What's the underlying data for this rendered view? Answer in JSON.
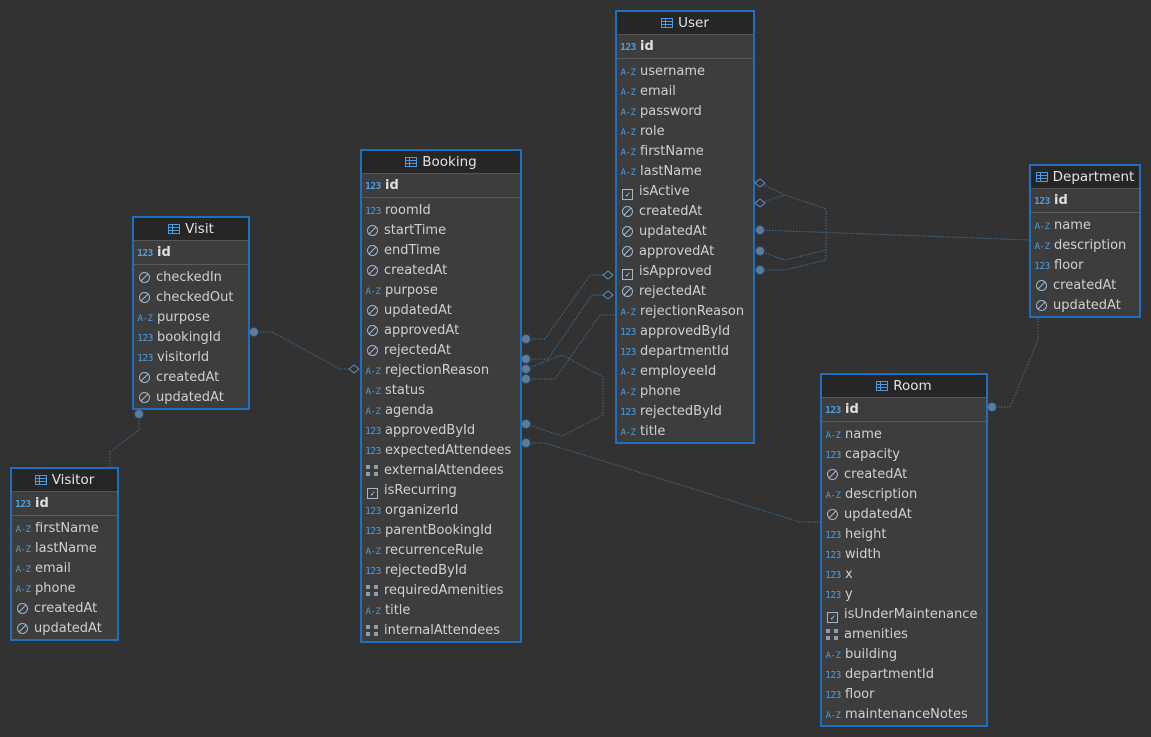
{
  "colors": {
    "background": "#323232",
    "entity_border": "#1e6fc0",
    "link": "#3f6f95",
    "icon": "#4d9de0"
  },
  "entities": {
    "user": {
      "title": "User",
      "pk": {
        "type": "num",
        "icon_text": "123",
        "name": "id"
      },
      "fields": [
        {
          "type": "az",
          "icon_text": "A-Z",
          "name": "username"
        },
        {
          "type": "az",
          "icon_text": "A-Z",
          "name": "email"
        },
        {
          "type": "az",
          "icon_text": "A-Z",
          "name": "password"
        },
        {
          "type": "az",
          "icon_text": "A-Z",
          "name": "role"
        },
        {
          "type": "az",
          "icon_text": "A-Z",
          "name": "firstName"
        },
        {
          "type": "az",
          "icon_text": "A-Z",
          "name": "lastName"
        },
        {
          "type": "bool",
          "icon_text": "✓",
          "name": "isActive"
        },
        {
          "type": "time",
          "icon_text": "",
          "name": "createdAt"
        },
        {
          "type": "time",
          "icon_text": "",
          "name": "updatedAt"
        },
        {
          "type": "time",
          "icon_text": "",
          "name": "approvedAt"
        },
        {
          "type": "bool",
          "icon_text": "✓",
          "name": "isApproved"
        },
        {
          "type": "time",
          "icon_text": "",
          "name": "rejectedAt"
        },
        {
          "type": "az",
          "icon_text": "A-Z",
          "name": "rejectionReason"
        },
        {
          "type": "num",
          "icon_text": "123",
          "name": "approvedById"
        },
        {
          "type": "num",
          "icon_text": "123",
          "name": "departmentId"
        },
        {
          "type": "az",
          "icon_text": "A-Z",
          "name": "employeeId"
        },
        {
          "type": "az",
          "icon_text": "A-Z",
          "name": "phone"
        },
        {
          "type": "num",
          "icon_text": "123",
          "name": "rejectedById"
        },
        {
          "type": "az",
          "icon_text": "A-Z",
          "name": "title"
        }
      ]
    },
    "booking": {
      "title": "Booking",
      "pk": {
        "type": "num",
        "icon_text": "123",
        "name": "id"
      },
      "fields": [
        {
          "type": "num",
          "icon_text": "123",
          "name": "roomId"
        },
        {
          "type": "time",
          "icon_text": "",
          "name": "startTime"
        },
        {
          "type": "time",
          "icon_text": "",
          "name": "endTime"
        },
        {
          "type": "time",
          "icon_text": "",
          "name": "createdAt"
        },
        {
          "type": "az",
          "icon_text": "A-Z",
          "name": "purpose"
        },
        {
          "type": "time",
          "icon_text": "",
          "name": "updatedAt"
        },
        {
          "type": "time",
          "icon_text": "",
          "name": "approvedAt"
        },
        {
          "type": "time",
          "icon_text": "",
          "name": "rejectedAt"
        },
        {
          "type": "az",
          "icon_text": "A-Z",
          "name": "rejectionReason"
        },
        {
          "type": "az",
          "icon_text": "A-Z",
          "name": "status"
        },
        {
          "type": "az",
          "icon_text": "A-Z",
          "name": "agenda"
        },
        {
          "type": "num",
          "icon_text": "123",
          "name": "approvedById"
        },
        {
          "type": "num",
          "icon_text": "123",
          "name": "expectedAttendees"
        },
        {
          "type": "arr",
          "icon_text": "",
          "name": "externalAttendees"
        },
        {
          "type": "bool",
          "icon_text": "✓",
          "name": "isRecurring"
        },
        {
          "type": "num",
          "icon_text": "123",
          "name": "organizerId"
        },
        {
          "type": "num",
          "icon_text": "123",
          "name": "parentBookingId"
        },
        {
          "type": "az",
          "icon_text": "A-Z",
          "name": "recurrenceRule"
        },
        {
          "type": "num",
          "icon_text": "123",
          "name": "rejectedById"
        },
        {
          "type": "arr",
          "icon_text": "",
          "name": "requiredAmenities"
        },
        {
          "type": "az",
          "icon_text": "A-Z",
          "name": "title"
        },
        {
          "type": "arr",
          "icon_text": "",
          "name": "internalAttendees"
        }
      ]
    },
    "visit": {
      "title": "Visit",
      "pk": {
        "type": "num",
        "icon_text": "123",
        "name": "id"
      },
      "fields": [
        {
          "type": "time",
          "icon_text": "",
          "name": "checkedIn"
        },
        {
          "type": "time",
          "icon_text": "",
          "name": "checkedOut"
        },
        {
          "type": "az",
          "icon_text": "A-Z",
          "name": "purpose"
        },
        {
          "type": "num",
          "icon_text": "123",
          "name": "bookingId"
        },
        {
          "type": "num",
          "icon_text": "123",
          "name": "visitorId"
        },
        {
          "type": "time",
          "icon_text": "",
          "name": "createdAt"
        },
        {
          "type": "time",
          "icon_text": "",
          "name": "updatedAt"
        }
      ]
    },
    "visitor": {
      "title": "Visitor",
      "pk": {
        "type": "num",
        "icon_text": "123",
        "name": "id"
      },
      "fields": [
        {
          "type": "az",
          "icon_text": "A-Z",
          "name": "firstName"
        },
        {
          "type": "az",
          "icon_text": "A-Z",
          "name": "lastName"
        },
        {
          "type": "az",
          "icon_text": "A-Z",
          "name": "email"
        },
        {
          "type": "az",
          "icon_text": "A-Z",
          "name": "phone"
        },
        {
          "type": "time",
          "icon_text": "",
          "name": "createdAt"
        },
        {
          "type": "time",
          "icon_text": "",
          "name": "updatedAt"
        }
      ]
    },
    "department": {
      "title": "Department",
      "pk": {
        "type": "num",
        "icon_text": "123",
        "name": "id"
      },
      "fields": [
        {
          "type": "az",
          "icon_text": "A-Z",
          "name": "name"
        },
        {
          "type": "az",
          "icon_text": "A-Z",
          "name": "description"
        },
        {
          "type": "num",
          "icon_text": "123",
          "name": "floor"
        },
        {
          "type": "time",
          "icon_text": "",
          "name": "createdAt"
        },
        {
          "type": "time",
          "icon_text": "",
          "name": "updatedAt"
        }
      ]
    },
    "room": {
      "title": "Room",
      "pk": {
        "type": "num",
        "icon_text": "123",
        "name": "id"
      },
      "fields": [
        {
          "type": "az",
          "icon_text": "A-Z",
          "name": "name"
        },
        {
          "type": "num",
          "icon_text": "123",
          "name": "capacity"
        },
        {
          "type": "time",
          "icon_text": "",
          "name": "createdAt"
        },
        {
          "type": "az",
          "icon_text": "A-Z",
          "name": "description"
        },
        {
          "type": "time",
          "icon_text": "",
          "name": "updatedAt"
        },
        {
          "type": "num",
          "icon_text": "123",
          "name": "height"
        },
        {
          "type": "num",
          "icon_text": "123",
          "name": "width"
        },
        {
          "type": "num",
          "icon_text": "123",
          "name": "x"
        },
        {
          "type": "num",
          "icon_text": "123",
          "name": "y"
        },
        {
          "type": "bool",
          "icon_text": "✓",
          "name": "isUnderMaintenance"
        },
        {
          "type": "arr",
          "icon_text": "",
          "name": "amenities"
        },
        {
          "type": "az",
          "icon_text": "A-Z",
          "name": "building"
        },
        {
          "type": "num",
          "icon_text": "123",
          "name": "departmentId"
        },
        {
          "type": "num",
          "icon_text": "123",
          "name": "floor"
        },
        {
          "type": "az",
          "icon_text": "A-Z",
          "name": "maintenanceNotes"
        }
      ]
    }
  }
}
